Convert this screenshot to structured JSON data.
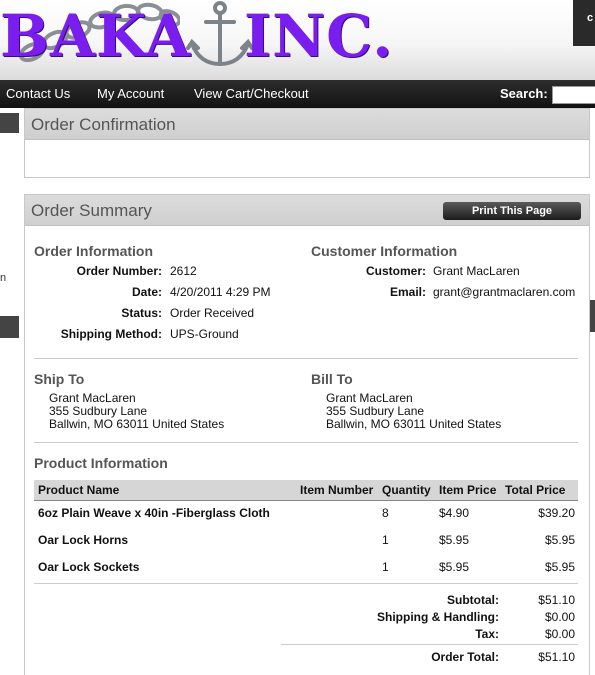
{
  "header": {
    "logo_left": "BAKA",
    "logo_right": "INC.",
    "corner_text": "c"
  },
  "nav": {
    "links": [
      "Contact Us",
      "My Account",
      "View Cart/Checkout"
    ],
    "search_label": "Search:",
    "search_value": ""
  },
  "order_confirmation": {
    "title": "Order Confirmation"
  },
  "order_summary": {
    "title": "Order Summary",
    "print_label": "Print This Page",
    "order_info": {
      "title": "Order Information",
      "fields": [
        {
          "label": "Order Number:",
          "value": "2612"
        },
        {
          "label": "Date:",
          "value": "4/20/2011 4:29 PM"
        },
        {
          "label": "Status:",
          "value": "Order Received"
        },
        {
          "label": "Shipping Method:",
          "value": "UPS-Ground"
        }
      ]
    },
    "customer_info": {
      "title": "Customer Information",
      "fields": [
        {
          "label": "Customer:",
          "value": "Grant MacLaren"
        },
        {
          "label": "Email:",
          "value": "grant@grantmaclaren.com"
        }
      ]
    },
    "ship_to": {
      "title": "Ship To",
      "lines": [
        "Grant MacLaren",
        "355 Sudbury Lane",
        "Ballwin, MO 63011 United States"
      ]
    },
    "bill_to": {
      "title": "Bill To",
      "lines": [
        "Grant MacLaren",
        "355 Sudbury Lane",
        "Ballwin, MO 63011 United States"
      ]
    },
    "product_info": {
      "title": "Product Information",
      "columns": [
        "Product Name",
        "Item Number",
        "Quantity",
        "Item Price",
        "Total Price"
      ],
      "rows": [
        {
          "name": "6oz Plain Weave x 40in -Fiberglass Cloth",
          "item_number": "",
          "quantity": "8",
          "item_price": "$4.90",
          "total_price": "$39.20"
        },
        {
          "name": "Oar Lock Horns",
          "item_number": "",
          "quantity": "1",
          "item_price": "$5.95",
          "total_price": "$5.95"
        },
        {
          "name": "Oar Lock Sockets",
          "item_number": "",
          "quantity": "1",
          "item_price": "$5.95",
          "total_price": "$5.95"
        }
      ]
    },
    "totals": [
      {
        "label": "Subtotal:",
        "value": "$51.10"
      },
      {
        "label": "Shipping & Handling:",
        "value": "$0.00"
      },
      {
        "label": "Tax:",
        "value": "$0.00"
      },
      {
        "label": "Order Total:",
        "value": "$51.10"
      }
    ]
  },
  "colors": {
    "logo": "#7a1ef0",
    "nav_bg": "#1a1a1a",
    "panel_head": "#d6d6d6"
  }
}
